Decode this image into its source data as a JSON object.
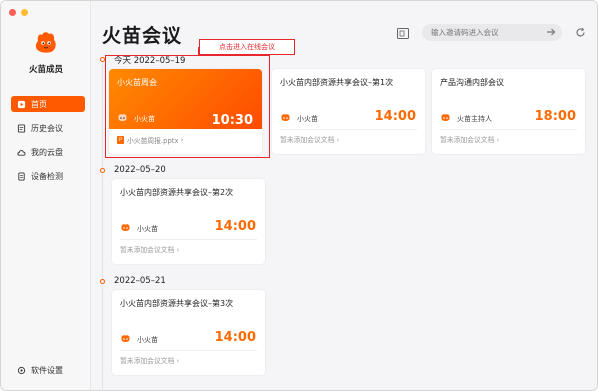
{
  "app": {
    "name": "火苗成员"
  },
  "sidebar": {
    "items": [
      {
        "label": "首页",
        "icon": "home-icon",
        "active": true
      },
      {
        "label": "历史会议",
        "icon": "history-icon",
        "active": false
      },
      {
        "label": "我的云盘",
        "icon": "cloud-icon",
        "active": false
      },
      {
        "label": "设备检测",
        "icon": "device-icon",
        "active": false
      }
    ],
    "settings": {
      "label": "软件设置",
      "icon": "settings-icon"
    }
  },
  "header": {
    "title": "火苗会议",
    "search_placeholder": "输入邀请码进入会议"
  },
  "annotation": {
    "callout": "点击进入在线会议"
  },
  "colors": {
    "accent": "#ff5a00",
    "time": "#ff6a00",
    "highlight": "#e8262d"
  },
  "groups": [
    {
      "date": "今天 2022–05–19",
      "meetings": [
        {
          "title": "小火苗周会",
          "host": "小火苗",
          "time": "10:30",
          "doc": "小火苗周报.pptx",
          "featured": true
        },
        {
          "title": "小火苗内部资源共享会议–第1次",
          "host": "小火苗",
          "time": "14:00",
          "doc": "暂未添加会议文档"
        },
        {
          "title": "产品沟通内部会议",
          "host": "火苗主持人",
          "time": "18:00",
          "doc": "暂未添加会议文档"
        }
      ]
    },
    {
      "date": "2022–05–20",
      "meetings": [
        {
          "title": "小火苗内部资源共享会议–第2次",
          "host": "小火苗",
          "time": "14:00",
          "doc": "暂未添加会议文档"
        }
      ]
    },
    {
      "date": "2022–05–21",
      "meetings": [
        {
          "title": "小火苗内部资源共享会议–第3次",
          "host": "小火苗",
          "time": "14:00",
          "doc": "暂未添加会议文档"
        }
      ]
    }
  ]
}
